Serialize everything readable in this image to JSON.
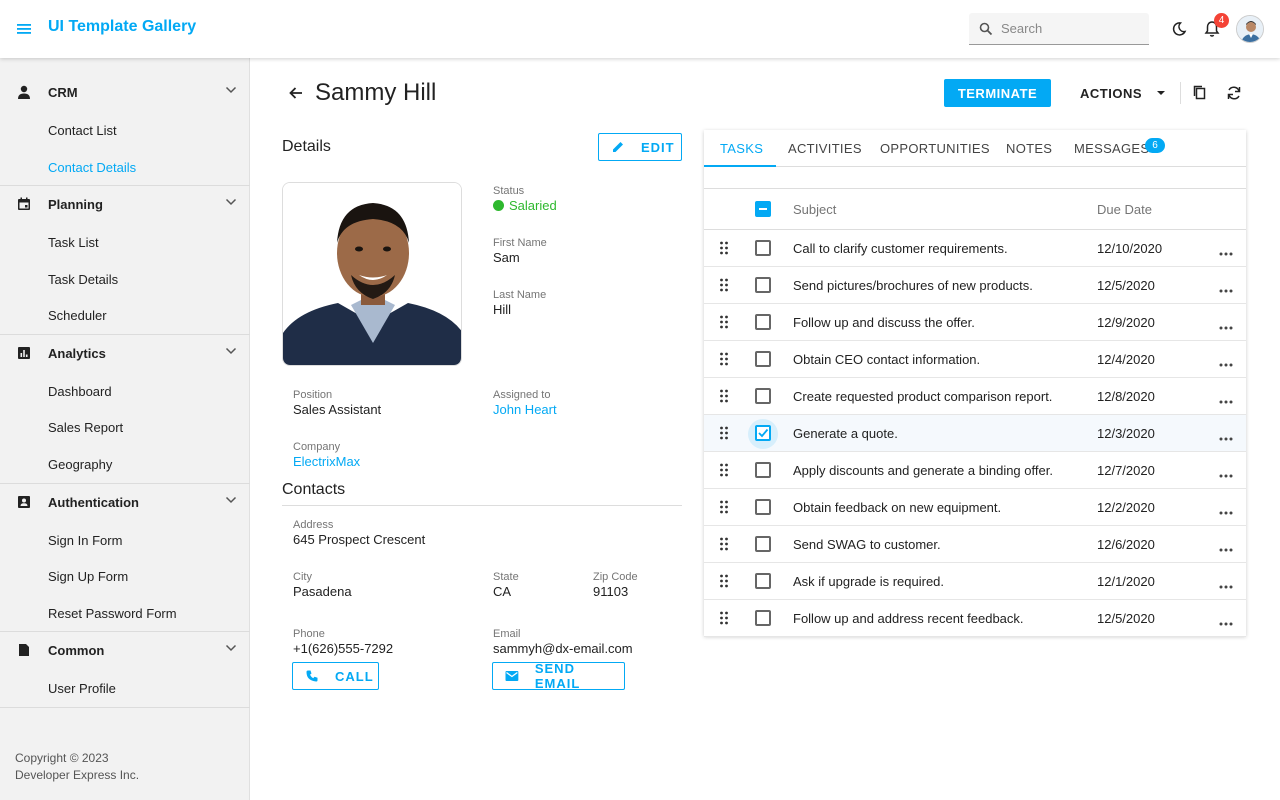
{
  "header": {
    "title": "UI Template Gallery",
    "search_placeholder": "Search",
    "notification_count": "4"
  },
  "sidebar": {
    "groups": [
      {
        "label": "CRM",
        "icon": "person-icon",
        "items": [
          "Contact List",
          "Contact Details"
        ]
      },
      {
        "label": "Planning",
        "icon": "calendar-icon",
        "items": [
          "Task List",
          "Task Details",
          "Scheduler"
        ]
      },
      {
        "label": "Analytics",
        "icon": "chart-icon",
        "items": [
          "Dashboard",
          "Sales Report",
          "Geography"
        ]
      },
      {
        "label": "Authentication",
        "icon": "contact-card-icon",
        "items": [
          "Sign In Form",
          "Sign Up Form",
          "Reset Password Form"
        ]
      },
      {
        "label": "Common",
        "icon": "folder-icon",
        "items": [
          "User Profile"
        ]
      }
    ],
    "active_item": "Contact Details",
    "copyright_line1": "Copyright © 2023",
    "copyright_line2": "Developer Express Inc."
  },
  "page": {
    "title": "Sammy Hill",
    "terminate_label": "TERMINATE",
    "actions_label": "ACTIONS"
  },
  "details": {
    "title": "Details",
    "edit_label": "EDIT",
    "status_label": "Status",
    "status_value": "Salaried",
    "status_color": "#2eb82e",
    "first_name_label": "First Name",
    "first_name": "Sam",
    "last_name_label": "Last Name",
    "last_name": "Hill",
    "position_label": "Position",
    "position": "Sales Assistant",
    "assigned_label": "Assigned to",
    "assigned": "John Heart",
    "company_label": "Company",
    "company": "ElectrixMax"
  },
  "contacts": {
    "title": "Contacts",
    "address_label": "Address",
    "address": "645 Prospect Crescent",
    "city_label": "City",
    "city": "Pasadena",
    "state_label": "State",
    "state": "CA",
    "zip_label": "Zip Code",
    "zip": "91103",
    "phone_label": "Phone",
    "phone": "+1(626)555-7292",
    "email_label": "Email",
    "email": "sammyh@dx-email.com",
    "call_label": "CALL",
    "send_email_label": "SEND EMAIL"
  },
  "tabs": {
    "items": [
      "TASKS",
      "ACTIVITIES",
      "OPPORTUNITIES",
      "NOTES",
      "MESSAGES"
    ],
    "active": "TASKS",
    "messages_count": "6"
  },
  "tasks": {
    "columns": {
      "subject": "Subject",
      "due_date": "Due Date"
    },
    "rows": [
      {
        "subject": "Call to clarify customer requirements.",
        "due": "12/10/2020",
        "checked": false
      },
      {
        "subject": "Send pictures/brochures of new products.",
        "due": "12/5/2020",
        "checked": false
      },
      {
        "subject": "Follow up and discuss the offer.",
        "due": "12/9/2020",
        "checked": false
      },
      {
        "subject": "Obtain CEO contact information.",
        "due": "12/4/2020",
        "checked": false
      },
      {
        "subject": "Create requested product comparison report.",
        "due": "12/8/2020",
        "checked": false
      },
      {
        "subject": "Generate a quote.",
        "due": "12/3/2020",
        "checked": true
      },
      {
        "subject": "Apply discounts and generate a binding offer.",
        "due": "12/7/2020",
        "checked": false
      },
      {
        "subject": "Obtain feedback on new equipment.",
        "due": "12/2/2020",
        "checked": false
      },
      {
        "subject": "Send SWAG to customer.",
        "due": "12/6/2020",
        "checked": false
      },
      {
        "subject": "Ask if upgrade is required.",
        "due": "12/1/2020",
        "checked": false
      },
      {
        "subject": "Follow up and address recent feedback.",
        "due": "12/5/2020",
        "checked": false
      }
    ]
  },
  "colors": {
    "accent": "#03a9f4",
    "badge_red": "#f44336"
  }
}
